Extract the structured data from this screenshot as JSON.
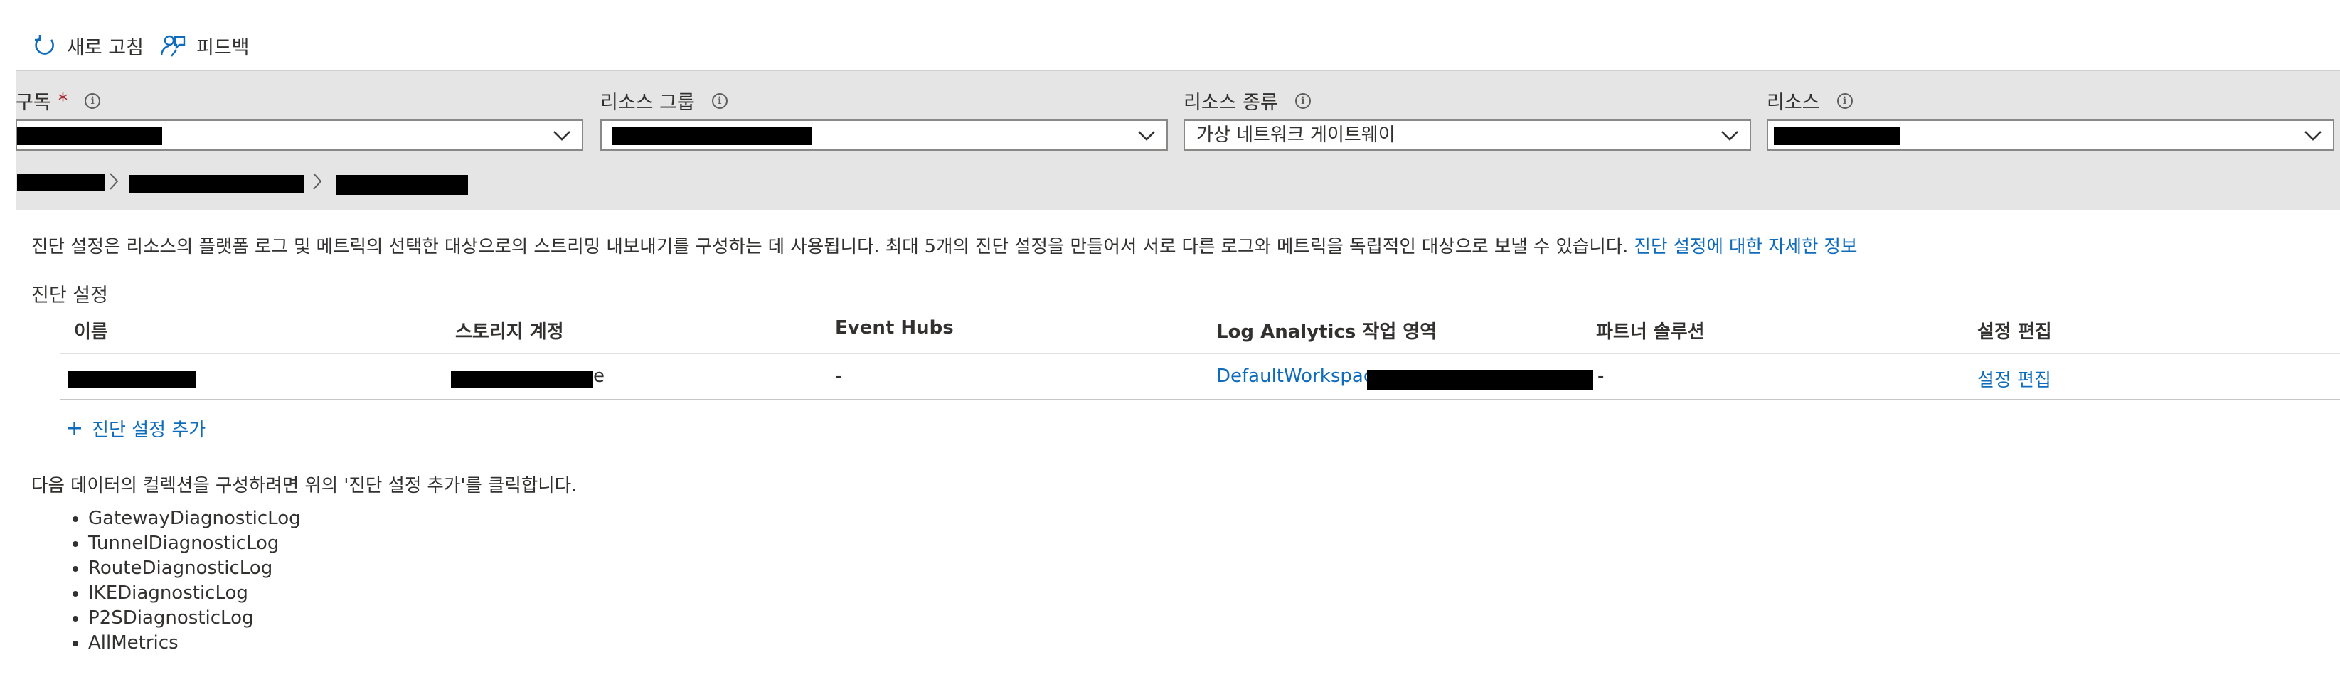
{
  "toolbar": {
    "refresh_label": "새로 고침",
    "feedback_label": "피드백"
  },
  "filters": {
    "subscription": {
      "label": "구독",
      "required_mark": "*",
      "value": ""
    },
    "resource_group": {
      "label": "리소스 그룹",
      "value": ""
    },
    "resource_type": {
      "label": "리소스 종류",
      "value": "가상 네트워크 게이트웨이"
    },
    "resource": {
      "label": "리소스",
      "value": ""
    },
    "info_glyph": "i"
  },
  "description": {
    "text": "진단 설정은 리소스의 플랫폼 로그 및 메트릭의 선택한 대상으로의 스트리밍 내보내기를 구성하는 데 사용됩니다. 최대 5개의 진단 설정을 만들어서 서로 다른 로그와 메트릭을 독립적인 대상으로 보낼 수 있습니다.",
    "link": "진단 설정에 대한 자세한 정보"
  },
  "section_title": "진단 설정",
  "table": {
    "headers": [
      "이름",
      "스토리지 계정",
      "Event Hubs",
      "Log Analytics 작업 영역",
      "파트너 솔루션",
      "설정 편집"
    ],
    "row": {
      "storage_suffix": "e",
      "event_hubs": "-",
      "workspace_prefix": "DefaultWorkspace-",
      "partner": "-",
      "edit": "설정 편집"
    }
  },
  "add_setting": {
    "icon": "+",
    "label": "진단 설정 추가"
  },
  "note": "다음 데이터의 컬렉션을 구성하려면 위의 '진단 설정 추가'를 클릭합니다.",
  "categories": [
    "GatewayDiagnosticLog",
    "TunnelDiagnosticLog",
    "RouteDiagnosticLog",
    "IKEDiagnosticLog",
    "P2SDiagnosticLog",
    "AllMetrics"
  ],
  "colors": {
    "accent": "#0f6cbd",
    "band": "#e5e5e5",
    "required": "#a4262c",
    "text": "#323130"
  }
}
